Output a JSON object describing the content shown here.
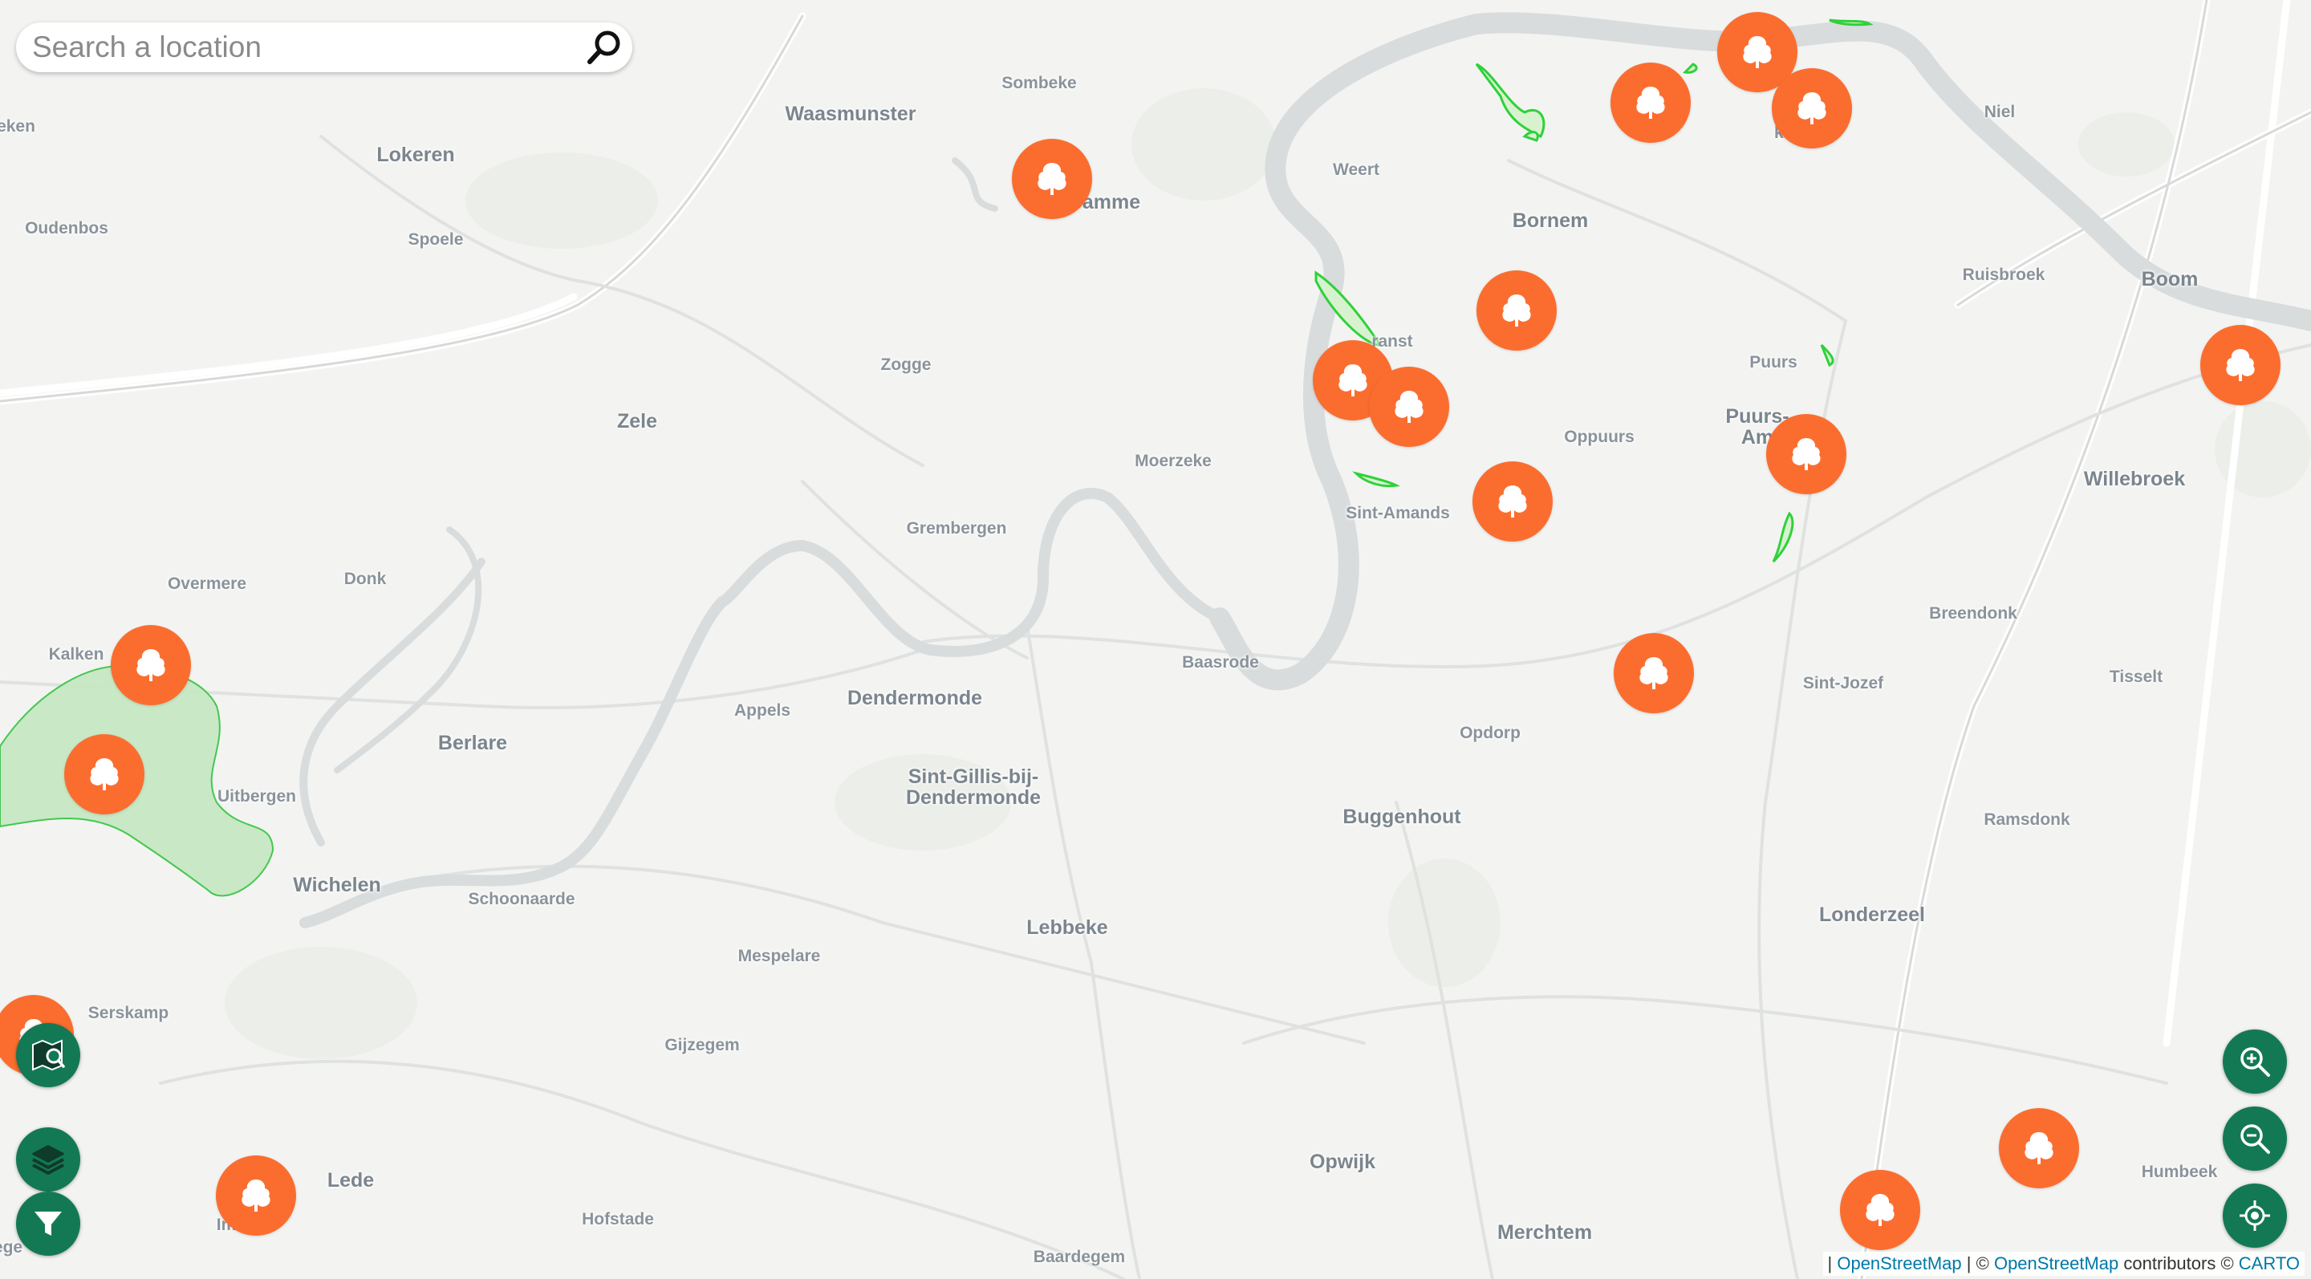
{
  "search": {
    "placeholder": "Search a location"
  },
  "map": {
    "places": [
      {
        "name": "Waasmunster",
        "kind": "town"
      },
      {
        "name": "Sombeke",
        "kind": "village"
      },
      {
        "name": "Lokeren",
        "kind": "town"
      },
      {
        "name": "Oudenbos",
        "kind": "village"
      },
      {
        "name": "Spoele",
        "kind": "village"
      },
      {
        "name": "eken",
        "kind": "village"
      },
      {
        "name": "amme",
        "kind": "town"
      },
      {
        "name": "Weert",
        "kind": "village"
      },
      {
        "name": "Bornem",
        "kind": "town"
      },
      {
        "name": "Niel",
        "kind": "village"
      },
      {
        "name": "kam",
        "kind": "village"
      },
      {
        "name": "Ruisbroek",
        "kind": "village"
      },
      {
        "name": "Boom",
        "kind": "town"
      },
      {
        "name": "Zogge",
        "kind": "village"
      },
      {
        "name": "Zele",
        "kind": "town"
      },
      {
        "name": "ranst",
        "kind": "village"
      },
      {
        "name": "Puurs",
        "kind": "village"
      },
      {
        "name": "Puurs-\nAm",
        "kind": "town"
      },
      {
        "name": "Oppuurs",
        "kind": "village"
      },
      {
        "name": "Moerzeke",
        "kind": "village"
      },
      {
        "name": "Willebroek",
        "kind": "town"
      },
      {
        "name": "Sint-Amands",
        "kind": "village"
      },
      {
        "name": "Grembergen",
        "kind": "village"
      },
      {
        "name": "Overmere",
        "kind": "village"
      },
      {
        "name": "Donk",
        "kind": "village"
      },
      {
        "name": "Breendonk",
        "kind": "village"
      },
      {
        "name": "Kalken",
        "kind": "village"
      },
      {
        "name": "Baasrode",
        "kind": "village"
      },
      {
        "name": "Tisselt",
        "kind": "village"
      },
      {
        "name": "Sint-Jozef",
        "kind": "village"
      },
      {
        "name": "Dendermonde",
        "kind": "town"
      },
      {
        "name": "Appels",
        "kind": "village"
      },
      {
        "name": "Opdorp",
        "kind": "village"
      },
      {
        "name": "Berlare",
        "kind": "town"
      },
      {
        "name": "Sint-Gillis-bij-\nDendermonde",
        "kind": "town"
      },
      {
        "name": "Uitbergen",
        "kind": "village"
      },
      {
        "name": "Buggenhout",
        "kind": "town"
      },
      {
        "name": "Ramsdonk",
        "kind": "village"
      },
      {
        "name": "Wichelen",
        "kind": "town"
      },
      {
        "name": "Schoonaarde",
        "kind": "village"
      },
      {
        "name": "Lebbeke",
        "kind": "town"
      },
      {
        "name": "Londerzeel",
        "kind": "town"
      },
      {
        "name": "Mespelare",
        "kind": "village"
      },
      {
        "name": "Serskamp",
        "kind": "village"
      },
      {
        "name": "Gijzegem",
        "kind": "village"
      },
      {
        "name": "Opwijk",
        "kind": "town"
      },
      {
        "name": "Humbeek",
        "kind": "village"
      },
      {
        "name": "Lede",
        "kind": "town"
      },
      {
        "name": "Im",
        "kind": "village"
      },
      {
        "name": "Hofstade",
        "kind": "village"
      },
      {
        "name": "Merchtem",
        "kind": "town"
      },
      {
        "name": "Baardegem",
        "kind": "village"
      },
      {
        "name": "ege",
        "kind": "village"
      }
    ],
    "marker_icon": "tree-icon",
    "marker_color": "#fb6d2f",
    "marker_count": 20
  },
  "controls": {
    "left": [
      {
        "name": "nearby-search-button",
        "icon": "map-search-icon"
      },
      {
        "name": "layers-button",
        "icon": "layers-icon"
      },
      {
        "name": "filter-button",
        "icon": "filter-icon"
      }
    ],
    "right": [
      {
        "name": "zoom-in-button",
        "icon": "zoom-in-icon"
      },
      {
        "name": "zoom-out-button",
        "icon": "zoom-out-icon"
      },
      {
        "name": "locate-button",
        "icon": "locate-icon"
      }
    ],
    "color": "#137955"
  },
  "attribution": {
    "separator": "|",
    "osm1": "OpenStreetMap",
    "middle": "| ©",
    "osm2": "OpenStreetMap",
    "contributors": "contributors ©",
    "carto": "CARTO"
  }
}
